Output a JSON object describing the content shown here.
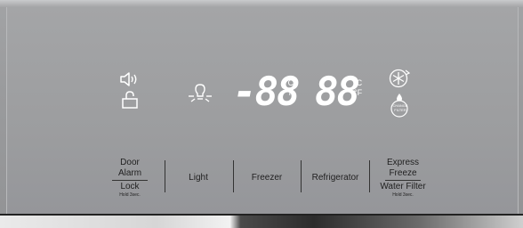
{
  "display": {
    "freezer_temp": "-88",
    "fridge_temp": "88",
    "celsius": "°C",
    "fahrenheit": "°F",
    "change_filter_badge": "CHANGE FILTER",
    "status_icons": [
      "sound-icon",
      "unlock-icon",
      "light-bulb-icon",
      "snowflake-express-icon",
      "water-drop-filter-icon"
    ]
  },
  "buttons": {
    "door_alarm_line1": "Door",
    "door_alarm_line2": "Alarm",
    "lock_label": "Lock",
    "lock_hold": "Hold 3sec.",
    "light": "Light",
    "freezer": "Freezer",
    "refrigerator": "Refrigerator",
    "express_line1": "Express",
    "express_line2": "Freeze",
    "water_filter": "Water Filter",
    "water_filter_hold": "Hold 3sec."
  },
  "colors": {
    "panel": "#9c9d9f",
    "display_lit": "#ffffff",
    "label_text": "#1f1f1f",
    "chrome_trim": "#2c2c2c"
  }
}
